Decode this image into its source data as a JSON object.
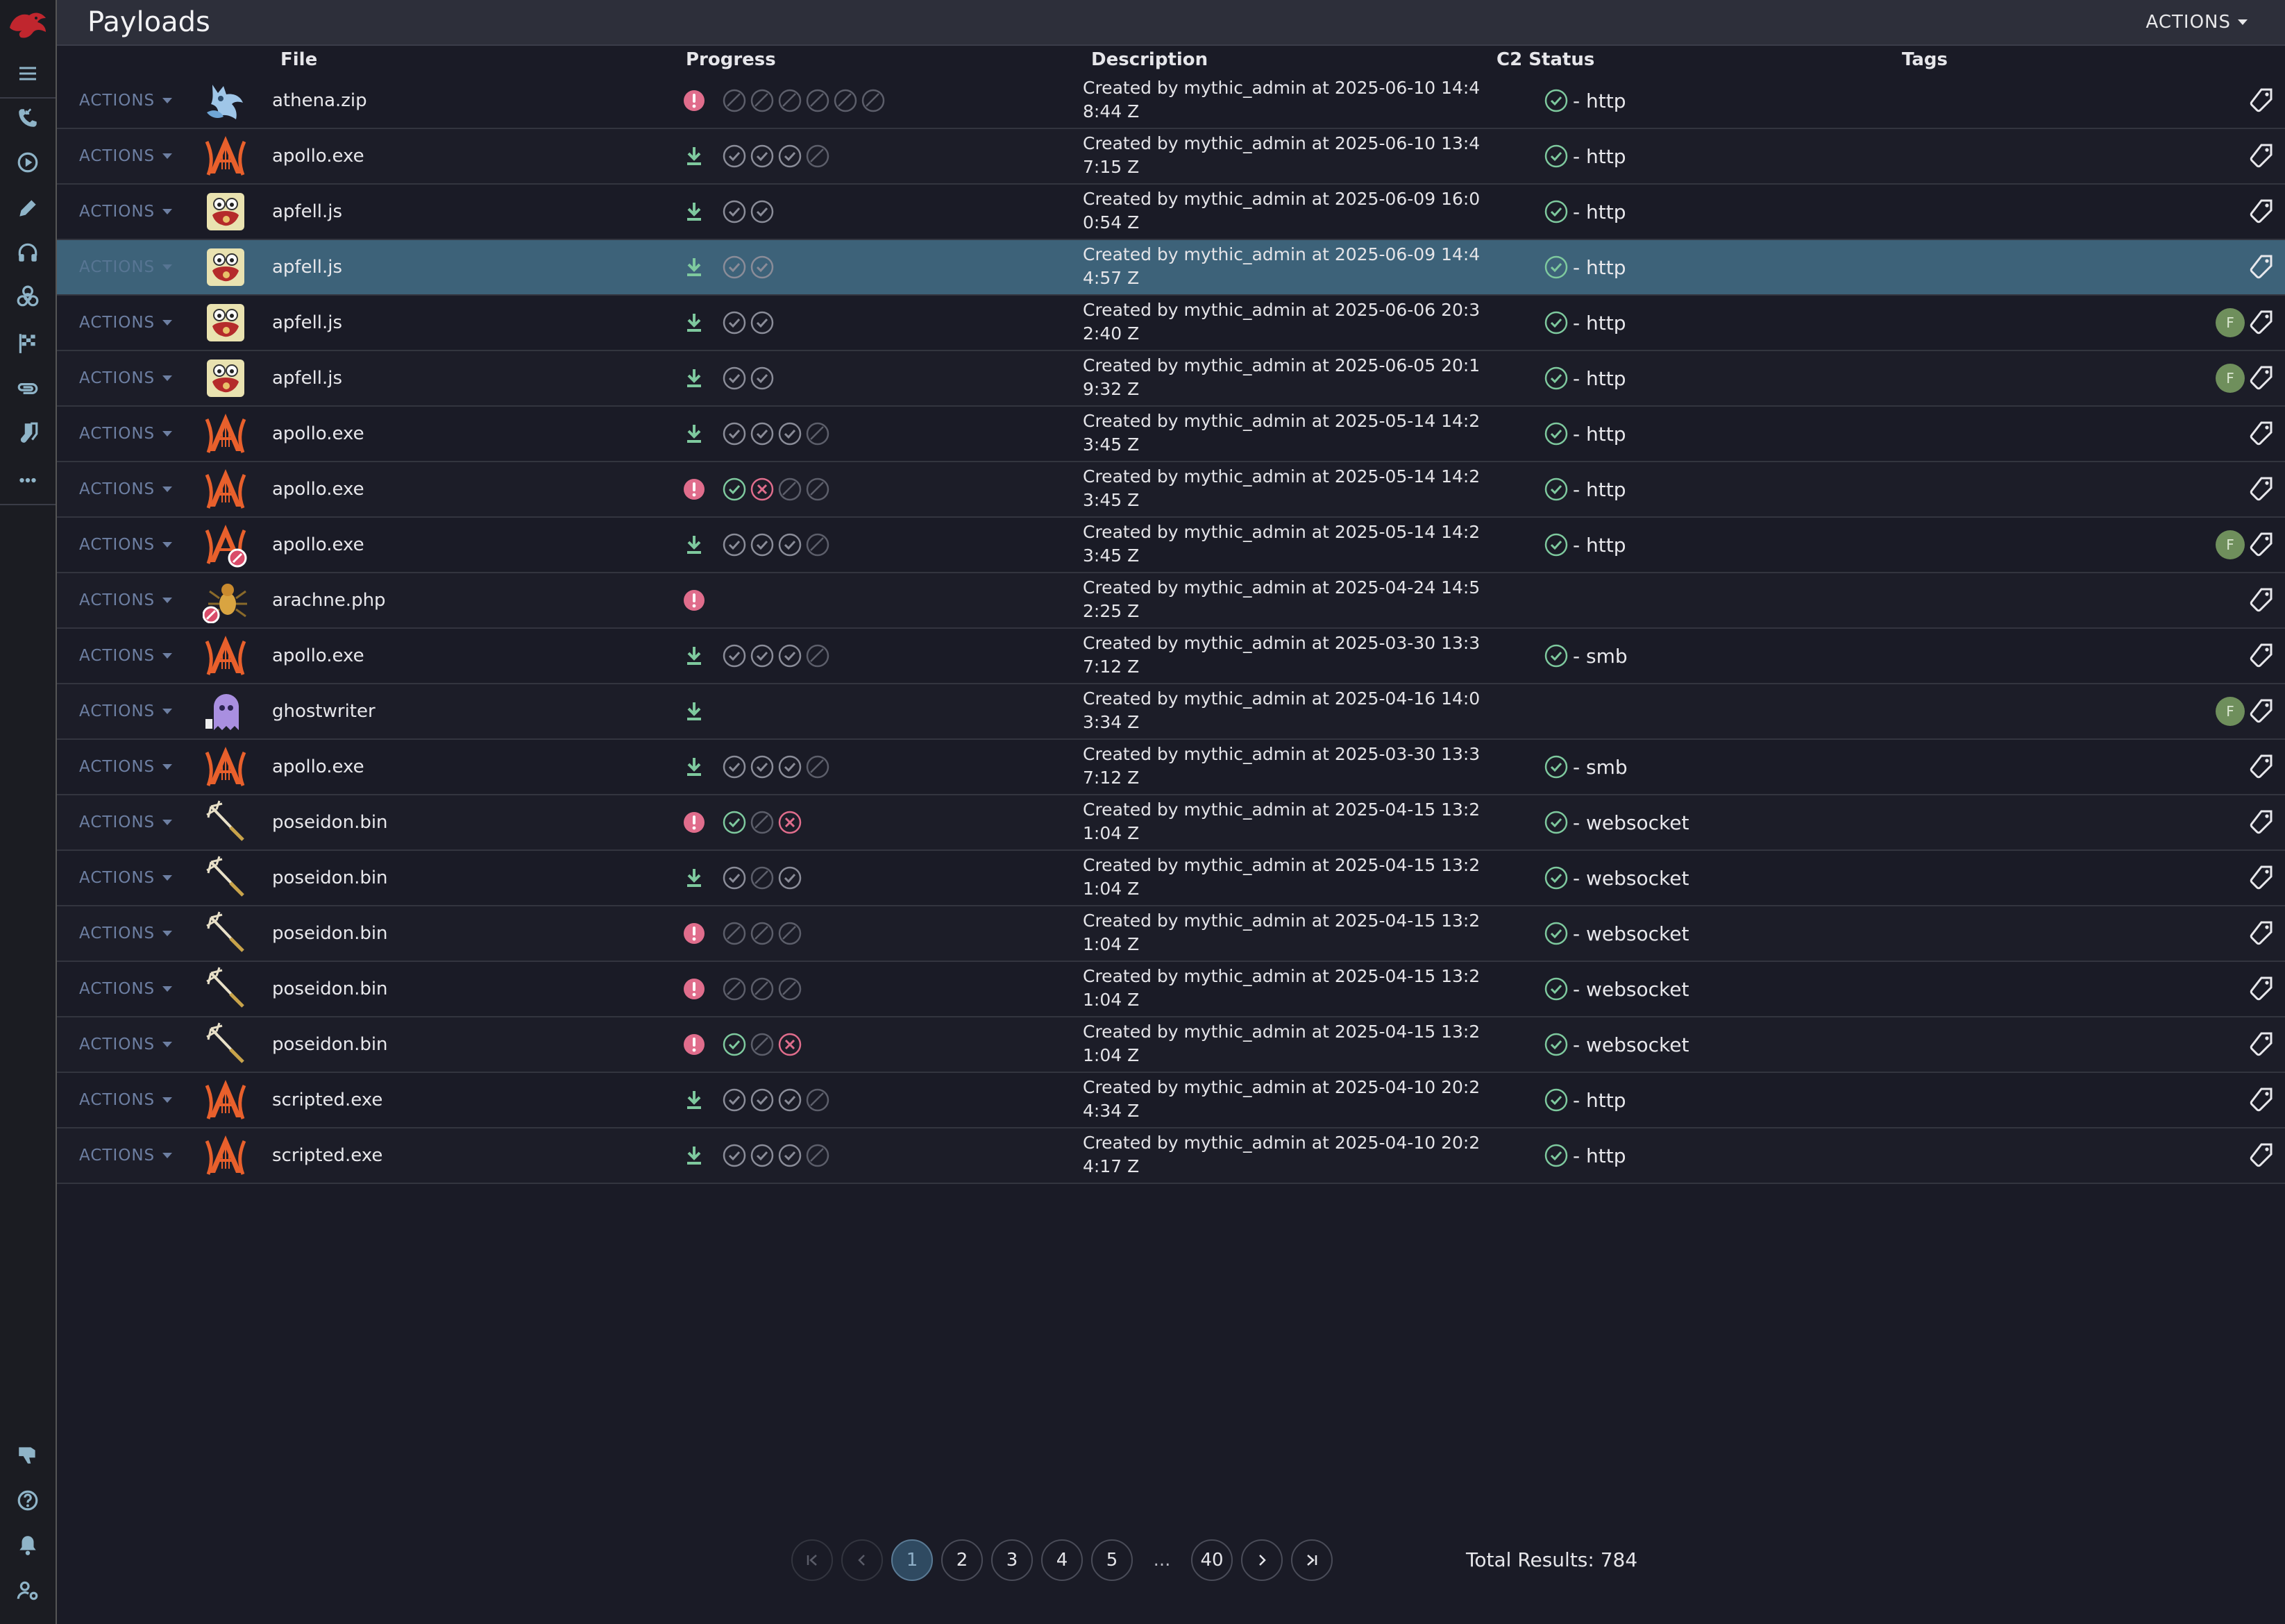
{
  "page": {
    "title": "Payloads",
    "top_actions_label": "ACTIONS"
  },
  "columns": {
    "file": "File",
    "progress": "Progress",
    "description": "Description",
    "c2_status": "C2 Status",
    "tags": "Tags"
  },
  "sidebar": {
    "items": [
      "menu-icon",
      "phone-callback-icon",
      "play-circle-icon",
      "pencil-icon",
      "headphones-icon",
      "biohazard-icon",
      "checkered-flag-icon",
      "paperclip-icon",
      "socks-icon",
      "more-icon"
    ],
    "bottom_items": [
      "thumbs-down-icon",
      "help-icon",
      "bell-icon",
      "user-settings-icon"
    ]
  },
  "colors": {
    "success": "#7ec99e",
    "error": "#e06d8c",
    "accent_blue": "#3d6279",
    "avatar": "#6f8f5c"
  },
  "row_action_label": "ACTIONS",
  "payloads": [
    {
      "icon": "athena-owl-icon",
      "file": "athena.zip",
      "lead": "error",
      "steps": [
        "skip",
        "skip",
        "skip",
        "skip",
        "skip",
        "skip"
      ],
      "description": "Created by mythic_admin at 2025-06-10 14:48:44 Z",
      "c2": "- http",
      "avatar": ""
    },
    {
      "icon": "apollo-lyre-icon",
      "file": "apollo.exe",
      "lead": "download",
      "steps": [
        "ok",
        "ok",
        "ok",
        "skip"
      ],
      "description": "Created by mythic_admin at 2025-06-10 13:47:15 Z",
      "c2": "- http",
      "avatar": ""
    },
    {
      "icon": "apfell-monkey-icon",
      "file": "apfell.js",
      "lead": "download",
      "steps": [
        "ok",
        "ok"
      ],
      "description": "Created by mythic_admin at 2025-06-09 16:00:54 Z",
      "c2": "- http",
      "avatar": ""
    },
    {
      "icon": "apfell-monkey-icon",
      "file": "apfell.js",
      "lead": "download",
      "steps": [
        "ok",
        "ok"
      ],
      "description": "Created by mythic_admin at 2025-06-09 14:44:57 Z",
      "c2": "- http",
      "avatar": "",
      "selected": true
    },
    {
      "icon": "apfell-monkey-icon",
      "file": "apfell.js",
      "lead": "download",
      "steps": [
        "ok",
        "ok"
      ],
      "description": "Created by mythic_admin at 2025-06-06 20:32:40 Z",
      "c2": "- http",
      "avatar": "F"
    },
    {
      "icon": "apfell-monkey-icon",
      "file": "apfell.js",
      "lead": "download",
      "steps": [
        "ok",
        "ok"
      ],
      "description": "Created by mythic_admin at 2025-06-05 20:19:32 Z",
      "c2": "- http",
      "avatar": "F"
    },
    {
      "icon": "apollo-lyre-icon",
      "file": "apollo.exe",
      "lead": "download",
      "steps": [
        "ok",
        "ok",
        "ok",
        "skip"
      ],
      "description": "Created by mythic_admin at 2025-05-14 14:23:45 Z",
      "c2": "- http",
      "avatar": ""
    },
    {
      "icon": "apollo-lyre-icon",
      "file": "apollo.exe",
      "lead": "error",
      "steps": [
        "okgreen",
        "fail",
        "skip",
        "skip"
      ],
      "description": "Created by mythic_admin at 2025-05-14 14:23:45 Z",
      "c2": "- http",
      "avatar": ""
    },
    {
      "icon": "apollo-lyre-deleted-icon",
      "file": "apollo.exe",
      "lead": "download",
      "steps": [
        "ok",
        "ok",
        "ok",
        "skip"
      ],
      "description": "Created by mythic_admin at 2025-05-14 14:23:45 Z",
      "c2": "- http",
      "avatar": "F"
    },
    {
      "icon": "arachne-spider-icon",
      "file": "arachne.php",
      "lead": "error",
      "steps": [],
      "description": "Created by mythic_admin at 2025-04-24 14:52:25 Z",
      "c2": "",
      "avatar": ""
    },
    {
      "icon": "apollo-lyre-icon",
      "file": "apollo.exe",
      "lead": "download",
      "steps": [
        "ok",
        "ok",
        "ok",
        "skip"
      ],
      "description": "Created by mythic_admin at 2025-03-30 13:37:12 Z",
      "c2": "- smb",
      "avatar": ""
    },
    {
      "icon": "ghostwriter-ghost-icon",
      "file": "ghostwriter",
      "lead": "download",
      "steps": [],
      "description": "Created by mythic_admin at 2025-04-16 14:03:34 Z",
      "c2": "",
      "avatar": "F"
    },
    {
      "icon": "apollo-lyre-icon",
      "file": "apollo.exe",
      "lead": "download",
      "steps": [
        "ok",
        "ok",
        "ok",
        "skip"
      ],
      "description": "Created by mythic_admin at 2025-03-30 13:37:12 Z",
      "c2": "- smb",
      "avatar": ""
    },
    {
      "icon": "poseidon-trident-icon",
      "file": "poseidon.bin",
      "lead": "error",
      "steps": [
        "okgreen",
        "skip",
        "fail"
      ],
      "description": "Created by mythic_admin at 2025-04-15 13:21:04 Z",
      "c2": "- websocket",
      "avatar": ""
    },
    {
      "icon": "poseidon-trident-icon",
      "file": "poseidon.bin",
      "lead": "download",
      "steps": [
        "ok",
        "skip",
        "ok"
      ],
      "description": "Created by mythic_admin at 2025-04-15 13:21:04 Z",
      "c2": "- websocket",
      "avatar": ""
    },
    {
      "icon": "poseidon-trident-icon",
      "file": "poseidon.bin",
      "lead": "error",
      "steps": [
        "skip",
        "skip",
        "skip"
      ],
      "description": "Created by mythic_admin at 2025-04-15 13:21:04 Z",
      "c2": "- websocket",
      "avatar": ""
    },
    {
      "icon": "poseidon-trident-icon",
      "file": "poseidon.bin",
      "lead": "error",
      "steps": [
        "skip",
        "skip",
        "skip"
      ],
      "description": "Created by mythic_admin at 2025-04-15 13:21:04 Z",
      "c2": "- websocket",
      "avatar": ""
    },
    {
      "icon": "poseidon-trident-icon",
      "file": "poseidon.bin",
      "lead": "error",
      "steps": [
        "okgreen",
        "skip",
        "fail"
      ],
      "description": "Created by mythic_admin at 2025-04-15 13:21:04 Z",
      "c2": "- websocket",
      "avatar": ""
    },
    {
      "icon": "apollo-lyre-icon",
      "file": "scripted.exe",
      "lead": "download",
      "steps": [
        "ok",
        "ok",
        "ok",
        "skip"
      ],
      "description": "Created by mythic_admin at 2025-04-10 20:24:34 Z",
      "c2": "- http",
      "avatar": ""
    },
    {
      "icon": "apollo-lyre-icon",
      "file": "scripted.exe",
      "lead": "download",
      "steps": [
        "ok",
        "ok",
        "ok",
        "skip"
      ],
      "description": "Created by mythic_admin at 2025-04-10 20:24:17 Z",
      "c2": "- http",
      "avatar": ""
    }
  ],
  "pagination": {
    "pages": [
      "1",
      "2",
      "3",
      "4",
      "5"
    ],
    "ellipsis": "...",
    "last": "40",
    "current": "1",
    "total_label": "Total Results: 784"
  }
}
